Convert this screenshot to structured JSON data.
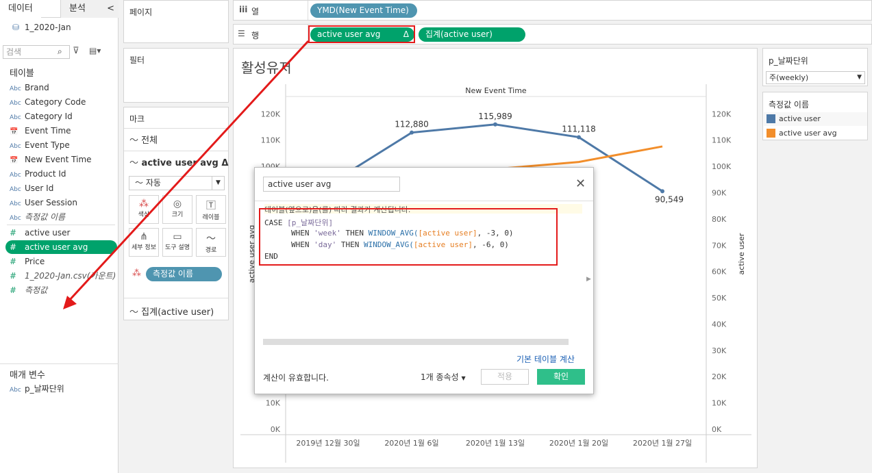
{
  "data_pane": {
    "tab_data": "데이터",
    "tab_analysis": "분석",
    "collapse": "<",
    "datasource": "1_2020-Jan",
    "search_placeholder": "검색",
    "tables_header": "테이블",
    "dimensions": [
      {
        "type": "Abc",
        "label": "Brand"
      },
      {
        "type": "Abc",
        "label": "Category Code"
      },
      {
        "type": "Abc",
        "label": "Category Id"
      },
      {
        "type": "date",
        "label": "Event Time"
      },
      {
        "type": "Abc",
        "label": "Event Type"
      },
      {
        "type": "date",
        "label": "New Event Time"
      },
      {
        "type": "Abc",
        "label": "Product Id"
      },
      {
        "type": "Abc",
        "label": "User Id"
      },
      {
        "type": "Abc",
        "label": "User Session"
      },
      {
        "type": "Abc",
        "label": "측정값 이름"
      }
    ],
    "measures": [
      {
        "label": "active user"
      },
      {
        "label": "active user avg"
      },
      {
        "label": "Price"
      },
      {
        "label": "1_2020-Jan.csv(카운트)"
      },
      {
        "label": "측정값"
      }
    ],
    "params_header": "매개 변수",
    "params": [
      {
        "type": "Abc",
        "label": "p_날짜단위"
      }
    ]
  },
  "shelves": {
    "pages": "페이지",
    "filters": "필터",
    "marks": "마크",
    "columns_label": "열",
    "rows_label": "행",
    "columns_pill": "YMD(New Event Time)",
    "rows_pill_1": "active user avg",
    "rows_pill_1_delta": "Δ",
    "rows_pill_2": "집계(active user)"
  },
  "marks_card": {
    "all": "전체",
    "card1": "active user avg Δ",
    "mark_type": "자동",
    "buttons": [
      "색상",
      "크기",
      "레이블",
      "세부 정보",
      "도구 설명",
      "경로"
    ],
    "color_pill": "측정값 이름",
    "card2": "집계(active user)"
  },
  "viz": {
    "title": "활성유저"
  },
  "right_pane": {
    "param_title": "p_날짜단위",
    "param_value": "주(weekly)",
    "legend_title": "측정값 이름",
    "legend": [
      {
        "label": "active user",
        "color": "#4e79a7"
      },
      {
        "label": "active user avg",
        "color": "#f28e2b"
      }
    ]
  },
  "dialog": {
    "name": "active user avg",
    "info": "테이블(옆으로)을(를) 따라 결과가 계산됩니다.",
    "code": {
      "case": "CASE",
      "param": "[p_날짜단위]",
      "when": "WHEN",
      "then": "THEN",
      "fn": "WINDOW_AVG(",
      "field": "[active user]",
      "week": "'week'",
      "day": "'day'",
      "week_args": ", -3, 0)",
      "day_args": ", -6, 0)",
      "end": "END"
    },
    "default_table_calc": "기본 테이블 계산",
    "valid": "계산이 유효합니다.",
    "dependencies": "1개 종속성",
    "apply": "적용",
    "ok": "확인"
  },
  "chart_data": {
    "type": "line",
    "title": "New Event Time",
    "categories": [
      "2019년 12월 30일",
      "2020년 1월 6일",
      "2020년 1월 13일",
      "2020년 1월 20일",
      "2020년 1월 27일"
    ],
    "y_ticks": [
      "120K",
      "110K",
      "100K",
      "90K",
      "80K",
      "70K",
      "60K",
      "50K",
      "40K",
      "30K",
      "20K",
      "10K",
      "0K"
    ],
    "ylim": [
      0,
      124000
    ],
    "ylabel_left": "active user avg",
    "ylabel_right": "active user",
    "series": [
      {
        "name": "active user",
        "color": "#4e79a7",
        "values": [
          93000,
          112880,
          115989,
          111118,
          90549
        ],
        "labels": [
          "",
          "112,880",
          "115,989",
          "111,118",
          "90,549"
        ]
      },
      {
        "name": "active user avg",
        "color": "#f28e2b",
        "values": [
          93000,
          96000,
          99000,
          101700,
          107600
        ]
      }
    ]
  }
}
